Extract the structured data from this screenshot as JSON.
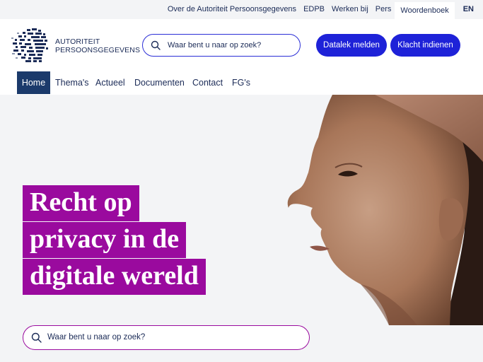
{
  "topbar": {
    "links": [
      "Over de Autoriteit Persoonsgegevens",
      "EDPB",
      "Werken bij",
      "Pers"
    ],
    "active_link": "Woordenboek",
    "language": "EN"
  },
  "logo": {
    "line1": "AUTORITEIT",
    "line2": "PERSOONSGEGEVENS"
  },
  "search": {
    "placeholder": "Waar bent u naar op zoek?"
  },
  "buttons": {
    "datalek": "Datalek melden",
    "klacht": "Klacht indienen"
  },
  "nav": {
    "items": [
      "Home",
      "Thema's",
      "Actueel",
      "Documenten",
      "Contact",
      "FG's"
    ],
    "active": "Home"
  },
  "hero": {
    "headline_lines": [
      "Recht op",
      "privacy in de",
      "digitale wereld"
    ],
    "search_placeholder": "Waar bent u naar op zoek?"
  },
  "colors": {
    "navy": "#1b2b57",
    "blue_button": "#1e22d8",
    "magenta": "#9a0a9e",
    "nav_active": "#1b3a6b"
  }
}
